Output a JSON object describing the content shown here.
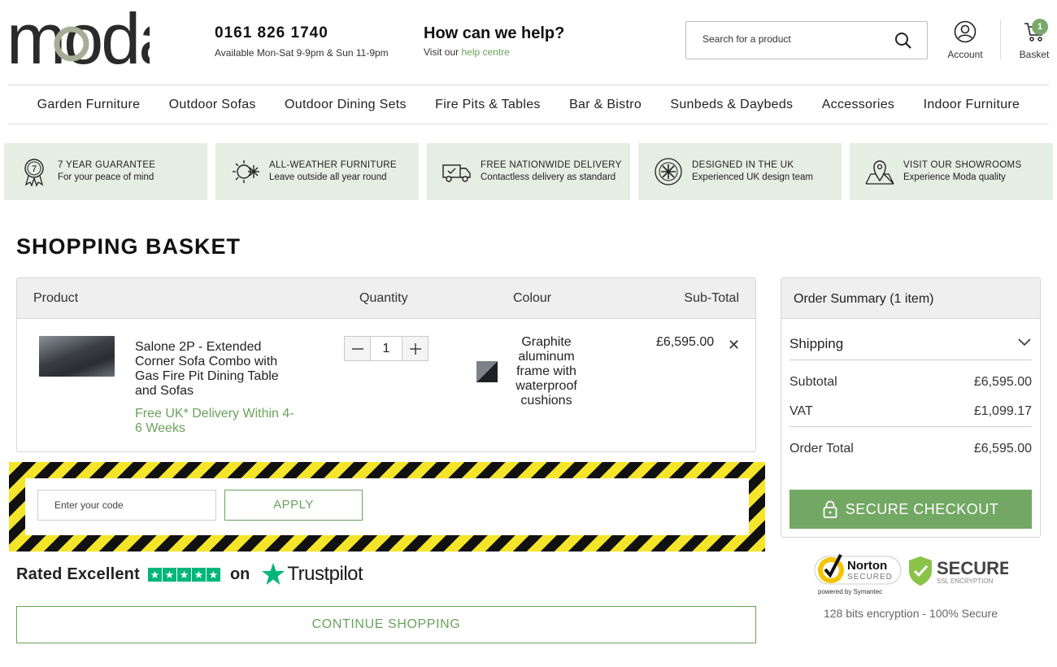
{
  "brand": {
    "logo_text": "moda",
    "accent": "#6aa35c",
    "usp_bg": "#e6ede2",
    "checkout_bg": "#72a863"
  },
  "header": {
    "phone": "0161 826 1740",
    "hours": "Available Mon-Sat 9-9pm & Sun 11-9pm",
    "help_title": "How can we help?",
    "help_prefix": "Visit our ",
    "help_link": "help centre",
    "search_placeholder": "Search for a product",
    "account_label": "Account",
    "basket_label": "Basket",
    "basket_count": "1"
  },
  "nav": [
    "Garden Furniture",
    "Outdoor Sofas",
    "Outdoor Dining Sets",
    "Fire Pits & Tables",
    "Bar & Bistro",
    "Sunbeds & Daybeds",
    "Accessories",
    "Indoor Furniture"
  ],
  "usps": [
    {
      "icon": "guarantee-medal-icon",
      "title": "7 Year Guarantee",
      "subtitle": "For your peace of mind"
    },
    {
      "icon": "sun-snowflake-icon",
      "title": "All-Weather Furniture",
      "subtitle": "Leave outside all year round"
    },
    {
      "icon": "delivery-truck-icon",
      "title": "Free Nationwide Delivery",
      "subtitle": "Contactless delivery as standard"
    },
    {
      "icon": "uk-flag-seal-icon",
      "title": "Designed in the UK",
      "subtitle": "Experienced UK design team"
    },
    {
      "icon": "map-pin-icon",
      "title": "Visit our Showrooms",
      "subtitle": "Experience Moda quality"
    }
  ],
  "page_title": "SHOPPING BASKET",
  "table": {
    "headers": {
      "product": "Product",
      "quantity": "Quantity",
      "colour": "Colour",
      "subtotal": "Sub-Total"
    },
    "items": [
      {
        "name": "Salone 2P - Extended Corner Sofa Combo with Gas Fire Pit Dining Table and Sofas",
        "delivery": "Free UK* Delivery Within 4-6 Weeks",
        "quantity": "1",
        "colour": "Graphite aluminum frame with waterproof cushions",
        "price": "£6,595.00",
        "remove_glyph": "✕"
      }
    ]
  },
  "coupon": {
    "placeholder": "Enter your code",
    "apply_label": "APPLY"
  },
  "trustpilot": {
    "rated": "Rated Excellent",
    "on": "on",
    "brand": "Trustpilot",
    "stars": 5
  },
  "continue_label": "CONTINUE SHOPPING",
  "summary": {
    "title": "Order Summary (1 item)",
    "shipping_label": "Shipping",
    "subtotal_label": "Subtotal",
    "subtotal_value": "£6,595.00",
    "vat_label": "VAT",
    "vat_value": "£1,099.17",
    "total_label": "Order Total",
    "total_value": "£6,595.00",
    "checkout_label": "SECURE CHECKOUT"
  },
  "badges": {
    "norton_title": "Norton",
    "norton_sub": "SECURED",
    "norton_powered": "powered by Symantec",
    "secure_title": "SECURE",
    "secure_sub": "SSL ENCRYPTION"
  },
  "encryption_text": "128 bits encryption - 100% Secure"
}
